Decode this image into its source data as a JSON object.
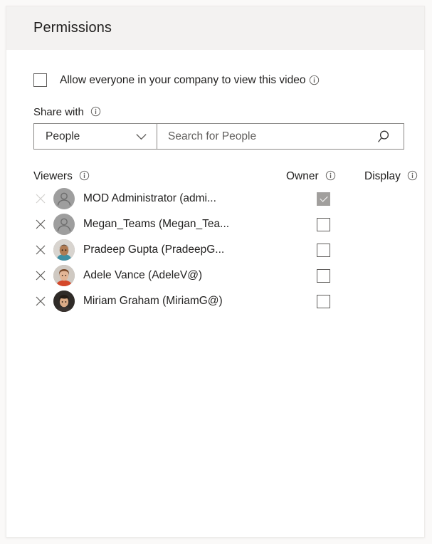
{
  "panel": {
    "title": "Permissions"
  },
  "allow_everyone": {
    "label": "Allow everyone in your company to view this video",
    "checked": false,
    "info_icon": "info-icon"
  },
  "share_with": {
    "label": "Share with",
    "info_icon": "info-icon",
    "dropdown": {
      "selected": "People",
      "chevron_icon": "chevron-down-icon"
    },
    "search": {
      "value": "",
      "placeholder": "Search for People",
      "icon": "search-icon"
    }
  },
  "table": {
    "columns": [
      {
        "label": "Viewers",
        "info_icon": "info-icon"
      },
      {
        "label": "Owner",
        "info_icon": "info-icon"
      },
      {
        "label": "Display",
        "info_icon": "info-icon"
      }
    ],
    "rows": [
      {
        "name": "MOD Administrator (admi...",
        "avatar": "default-person-avatar",
        "avatar_colors": {
          "bg": "#9e9e9e",
          "fg": "#6e6e6e"
        },
        "owner_checked": true,
        "owner_disabled": true,
        "remove_icon": "close-icon",
        "remove_disabled": true
      },
      {
        "name": "Megan_Teams (Megan_Tea...",
        "avatar": "default-person-avatar",
        "avatar_colors": {
          "bg": "#9e9e9e",
          "fg": "#6e6e6e"
        },
        "owner_checked": false,
        "owner_disabled": false,
        "remove_icon": "close-icon",
        "remove_disabled": false
      },
      {
        "name": "Pradeep Gupta (PradeepG...",
        "avatar": "photo-avatar",
        "avatar_colors": {
          "bg": "#d8d4cf",
          "hair": "#2b2118",
          "skin": "#b07b53",
          "shirt": "#3f8fa3"
        },
        "owner_checked": false,
        "owner_disabled": false,
        "remove_icon": "close-icon",
        "remove_disabled": false
      },
      {
        "name": "Adele Vance (AdeleV@)",
        "avatar": "photo-avatar",
        "avatar_colors": {
          "bg": "#cfc9c2",
          "hair": "#7a4a2a",
          "skin": "#e3b595",
          "shirt": "#d4482a"
        },
        "owner_checked": false,
        "owner_disabled": false,
        "remove_icon": "close-icon",
        "remove_disabled": false
      },
      {
        "name": "Miriam Graham (MiriamG@)",
        "avatar": "photo-avatar",
        "avatar_colors": {
          "bg": "#2f2b28",
          "hair": "#241c16",
          "skin": "#dcab86",
          "shirt": "#3a3330"
        },
        "owner_checked": false,
        "owner_disabled": false,
        "remove_icon": "close-icon",
        "remove_disabled": false
      }
    ]
  },
  "colors": {
    "header_bg": "#f3f2f1",
    "panel_bg": "#ffffff",
    "page_bg": "#faf9f8",
    "text": "#201f1e",
    "border": "#8a8886"
  }
}
